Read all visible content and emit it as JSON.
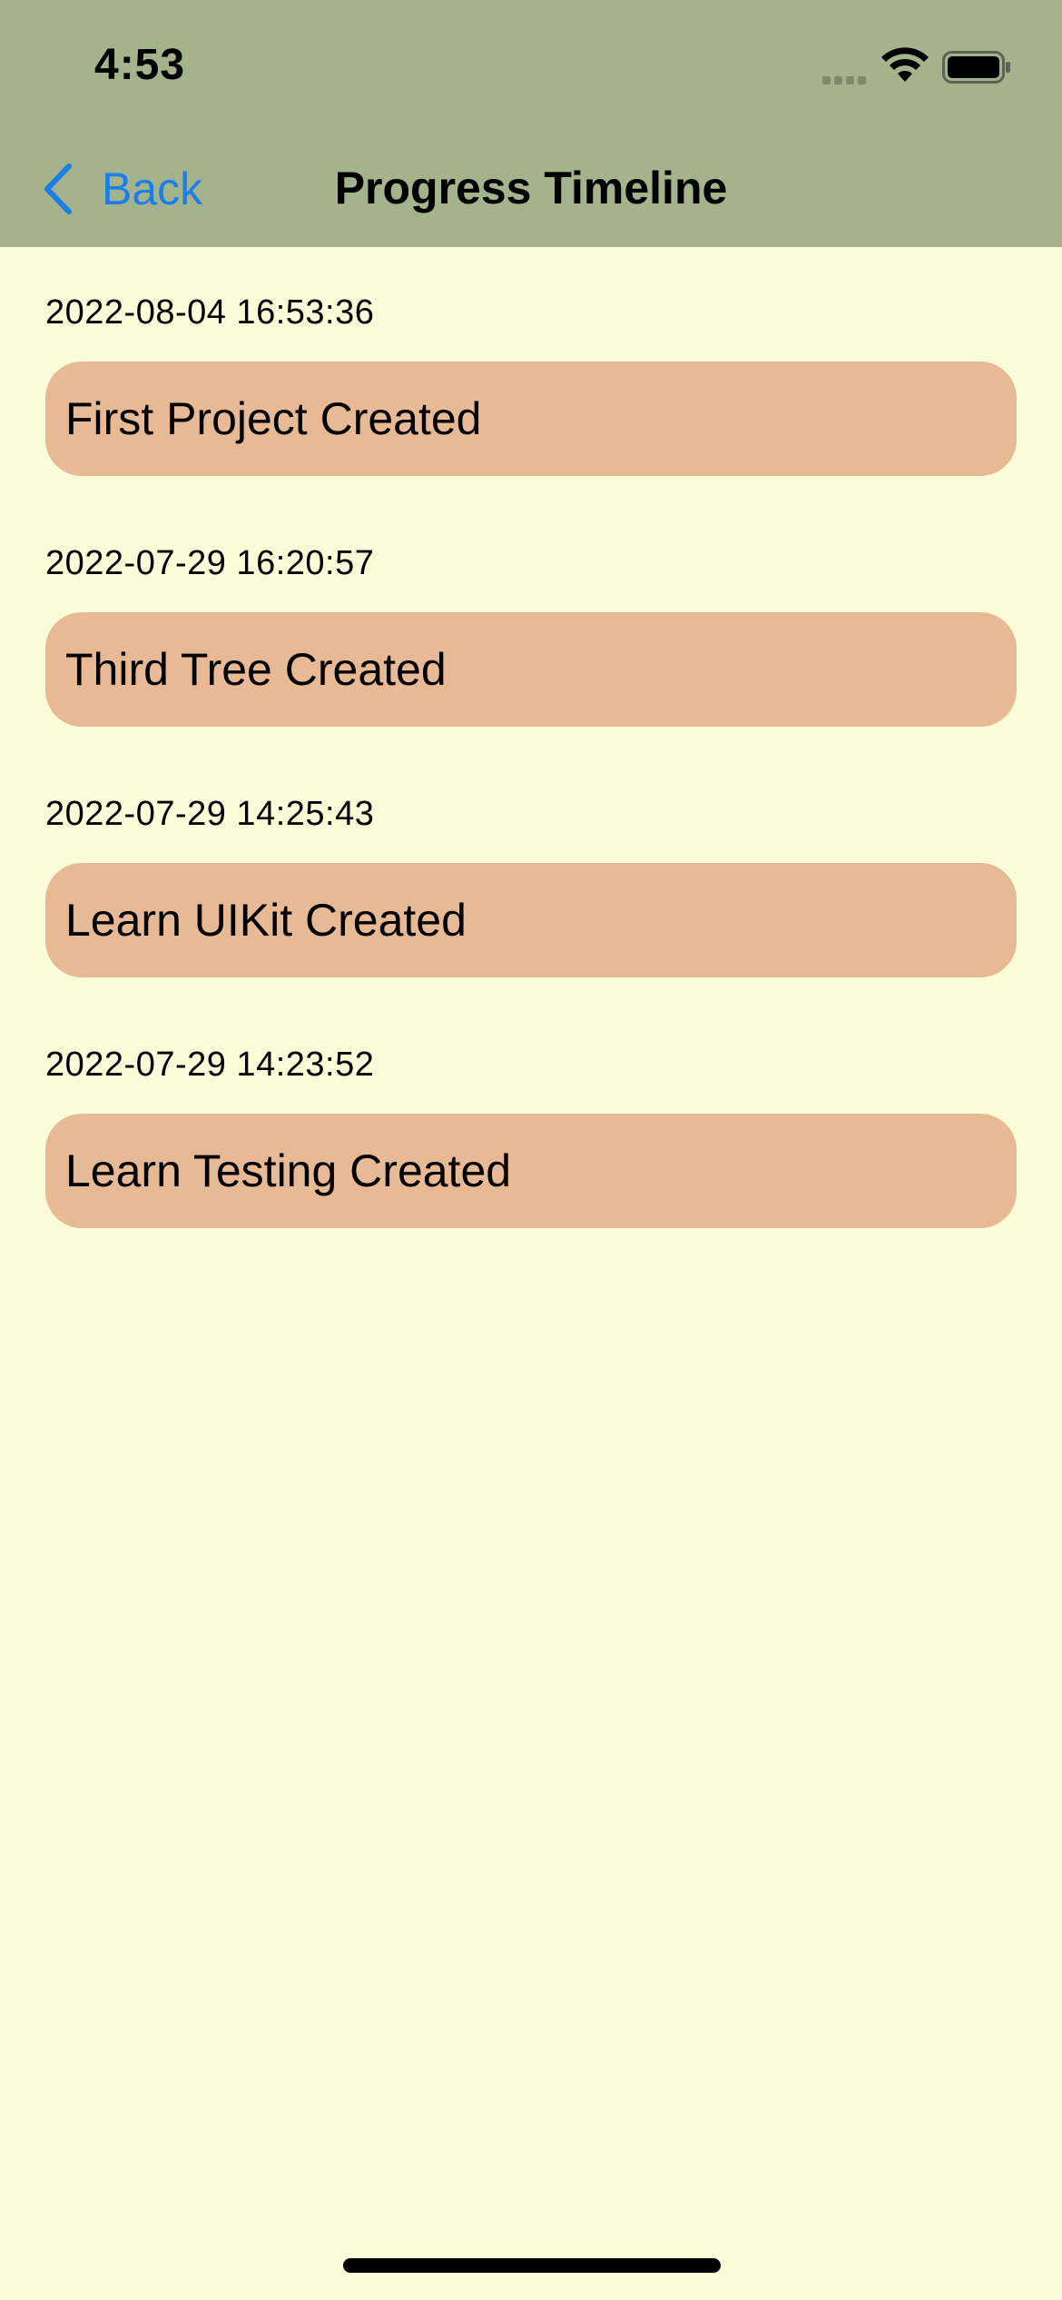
{
  "status_bar": {
    "time": "4:53",
    "icons": [
      "cellular-signal-icon",
      "wifi-icon",
      "battery-icon"
    ]
  },
  "nav": {
    "back_label": "Back",
    "title": "Progress Timeline"
  },
  "timeline": {
    "entries": [
      {
        "date": "2022-08-04 16:53:36",
        "title": "First Project Created"
      },
      {
        "date": "2022-07-29 16:20:57",
        "title": "Third Tree Created"
      },
      {
        "date": "2022-07-29 14:25:43",
        "title": "Learn UIKit Created"
      },
      {
        "date": "2022-07-29 14:23:52",
        "title": "Learn Testing Created"
      }
    ]
  },
  "colors": {
    "header_bg": "#a4b38b",
    "page_bg": "#fbfdd9",
    "card_bg": "#e7b995",
    "accent": "#1c7fe8"
  }
}
